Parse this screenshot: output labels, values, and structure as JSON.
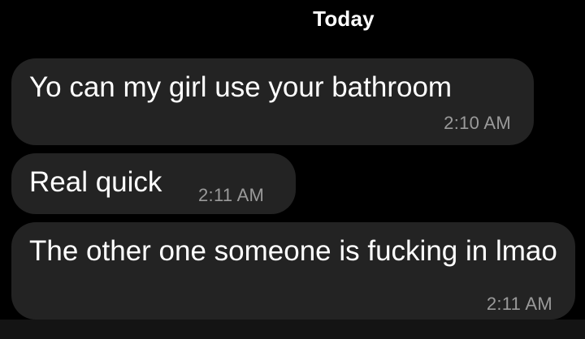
{
  "conversation": {
    "date_divider": "Today",
    "messages": [
      {
        "text": "Yo can my girl use your bathroom",
        "time": "2:10 AM"
      },
      {
        "text": "Real quick",
        "time": "2:11 AM"
      },
      {
        "text": "The other one someone is fucking in lmao",
        "time": "2:11 AM"
      }
    ]
  },
  "colors": {
    "background": "#000000",
    "bubble": "#232323",
    "text": "#ffffff",
    "timestamp": "#9a9a9a"
  }
}
